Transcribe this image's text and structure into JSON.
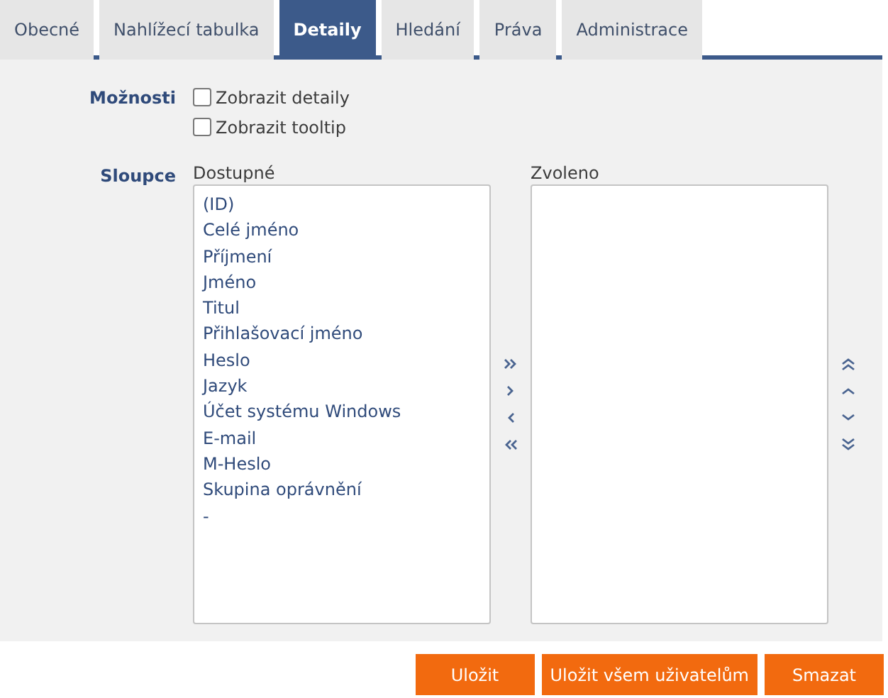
{
  "tabs": [
    {
      "label": "Obecné",
      "selected": false
    },
    {
      "label": "Nahlížecí tabulka",
      "selected": false
    },
    {
      "label": "Detaily",
      "selected": true
    },
    {
      "label": "Hledání",
      "selected": false
    },
    {
      "label": "Práva",
      "selected": false
    },
    {
      "label": "Administrace",
      "selected": false
    }
  ],
  "options": {
    "label": "Možnosti",
    "checkboxes": [
      {
        "label": "Zobrazit detaily",
        "checked": false
      },
      {
        "label": "Zobrazit tooltip",
        "checked": false
      }
    ]
  },
  "columns": {
    "label": "Sloupce",
    "available": {
      "title": "Dostupné",
      "items": [
        "(ID)",
        "Celé jméno",
        "Příjmení",
        "Jméno",
        "Titul",
        "Přihlašovací jméno",
        "Heslo",
        "Jazyk",
        "Účet systému Windows",
        "E-mail",
        "M-Heslo",
        "Skupina oprávnění",
        "-"
      ]
    },
    "selected": {
      "title": "Zvoleno"
    }
  },
  "buttons": [
    "Uložit",
    "Uložit všem uživatelům",
    "Smazat"
  ]
}
